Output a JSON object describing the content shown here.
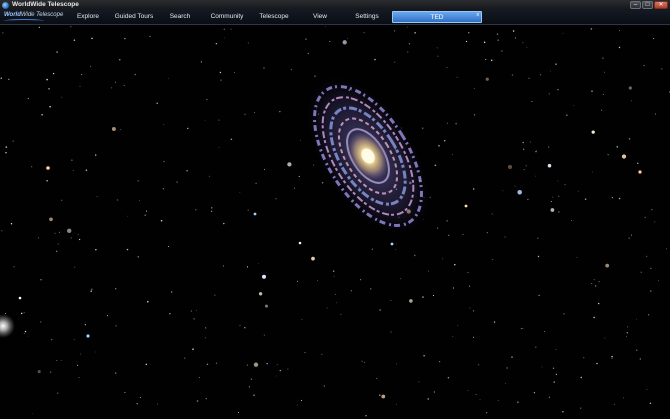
{
  "window": {
    "title": "WorldWide Telescope",
    "controls": {
      "minimize": "–",
      "maximize": "□",
      "close": "✕"
    }
  },
  "logo": {
    "word1": "World",
    "word2": "Wide Telescope"
  },
  "menu": {
    "explore": "Explore",
    "guided_tours": "Guided Tours",
    "search": "Search",
    "community": "Community",
    "telescope": "Telescope",
    "view": "View",
    "settings": "Settings",
    "active_tab": "TED",
    "active_tab_close": "x"
  },
  "icons": {
    "app": "wwt-app-icon",
    "close": "close-icon"
  },
  "colors": {
    "menu_active_bg": "#4a8ddd",
    "sky_bg": "#010102",
    "galaxy_core": "#f5e6a8",
    "galaxy_arms": "#9b8ff0"
  }
}
